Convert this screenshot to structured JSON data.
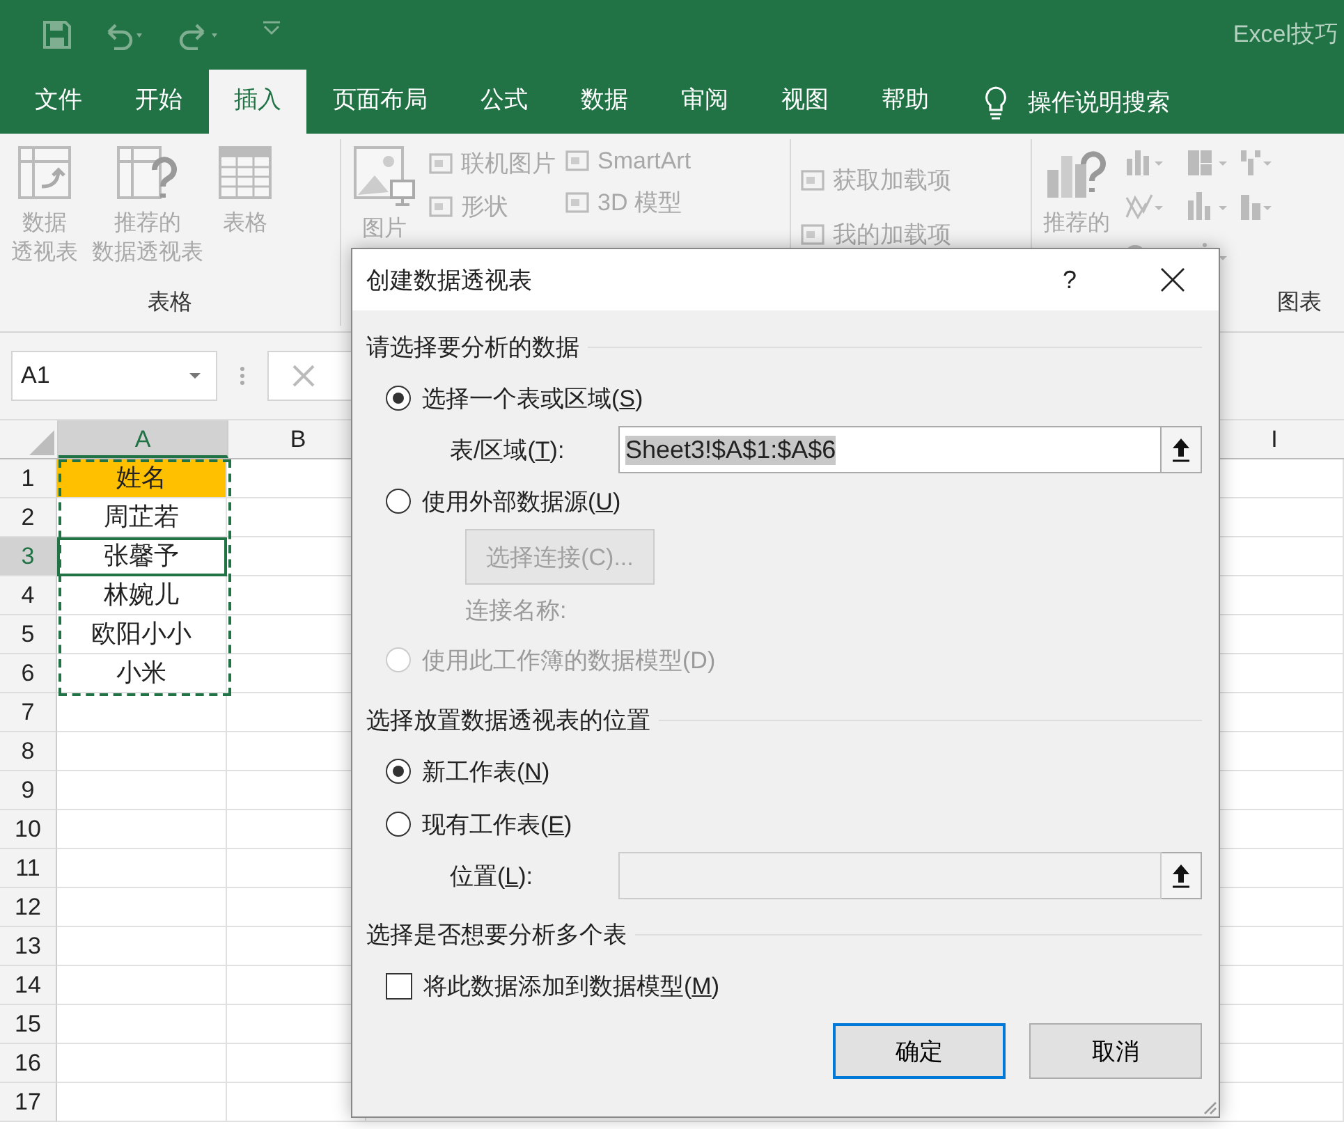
{
  "titlebar": {
    "title": "Excel技巧"
  },
  "ribbon_tabs": [
    {
      "label": "文件",
      "selected": false
    },
    {
      "label": "开始",
      "selected": false
    },
    {
      "label": "插入",
      "selected": true
    },
    {
      "label": "页面布局",
      "selected": false
    },
    {
      "label": "公式",
      "selected": false
    },
    {
      "label": "数据",
      "selected": false
    },
    {
      "label": "审阅",
      "selected": false
    },
    {
      "label": "视图",
      "selected": false
    },
    {
      "label": "帮助",
      "selected": false
    }
  ],
  "tell_me": "操作说明搜索",
  "ribbon_groups": [
    {
      "kind": "tables",
      "label": "表格",
      "large": [
        [
          "数据",
          "透视表"
        ],
        [
          "推荐的",
          "数据透视表"
        ],
        [
          "表格"
        ]
      ]
    },
    {
      "kind": "illustrations",
      "large": [
        [
          "图片"
        ]
      ],
      "columns": [
        [
          "联机图片",
          "形状"
        ],
        [
          "SmartArt",
          "3D 模型"
        ]
      ]
    },
    {
      "kind": "addins",
      "columns": [
        [
          "获取加载项",
          "我的加载项"
        ]
      ]
    },
    {
      "kind": "charts",
      "label": "图表",
      "large": [
        [
          "推荐的"
        ]
      ]
    }
  ],
  "name_box": "A1",
  "columns": [
    "A",
    "B",
    "I"
  ],
  "rows": [
    {
      "number": "1",
      "value": "姓名",
      "header": true,
      "selected": false
    },
    {
      "number": "2",
      "value": "周芷若",
      "header": false,
      "selected": false
    },
    {
      "number": "3",
      "value": "张馨予",
      "header": false,
      "selected": true
    },
    {
      "number": "4",
      "value": "林婉儿",
      "header": false,
      "selected": false
    },
    {
      "number": "5",
      "value": "欧阳小小",
      "header": false,
      "selected": false
    },
    {
      "number": "6",
      "value": "小米",
      "header": false,
      "selected": false
    },
    {
      "number": "7"
    },
    {
      "number": "8"
    },
    {
      "number": "9"
    },
    {
      "number": "10"
    },
    {
      "number": "11"
    },
    {
      "number": "12"
    },
    {
      "number": "13"
    },
    {
      "number": "14"
    },
    {
      "number": "15"
    },
    {
      "number": "16"
    },
    {
      "number": "17"
    }
  ],
  "dialog": {
    "title": "创建数据透视表",
    "help": "?",
    "items": [
      {
        "kind": "heading",
        "label": "请选择要分析的数据"
      },
      {
        "kind": "radio",
        "label": "选择一个表或区域(",
        "key": "S",
        "tail": ")",
        "selected": true,
        "disabled": false
      },
      {
        "kind": "field",
        "label": "表/区域(",
        "key": "T",
        "tail": "):",
        "value": "Sheet3!$A$1:$A$6",
        "disabled": false
      },
      {
        "kind": "radio",
        "label": "使用外部数据源(",
        "key": "U",
        "tail": ")",
        "selected": false,
        "disabled": false
      },
      {
        "kind": "button",
        "label": "选择连接(C)...",
        "disabled": true
      },
      {
        "kind": "note",
        "label": "连接名称:",
        "disabled": true
      },
      {
        "kind": "radio",
        "label": "使用此工作簿的数据模型(D)",
        "selected": false,
        "disabled": true
      },
      {
        "kind": "heading",
        "label": "选择放置数据透视表的位置"
      },
      {
        "kind": "radio",
        "label": "新工作表(",
        "key": "N",
        "tail": ")",
        "selected": true,
        "disabled": false
      },
      {
        "kind": "radio",
        "label": "现有工作表(",
        "key": "E",
        "tail": ")",
        "selected": false,
        "disabled": false
      },
      {
        "kind": "field",
        "label": "位置(",
        "key": "L",
        "tail": "):",
        "disabled": true
      },
      {
        "kind": "heading",
        "label": "选择是否想要分析多个表"
      },
      {
        "kind": "checkbox",
        "label": "将此数据添加到数据模型(",
        "key": "M",
        "tail": ")",
        "checked": false
      }
    ],
    "buttons": [
      {
        "label": "确定",
        "default": true
      },
      {
        "label": "取消",
        "default": false
      }
    ]
  }
}
